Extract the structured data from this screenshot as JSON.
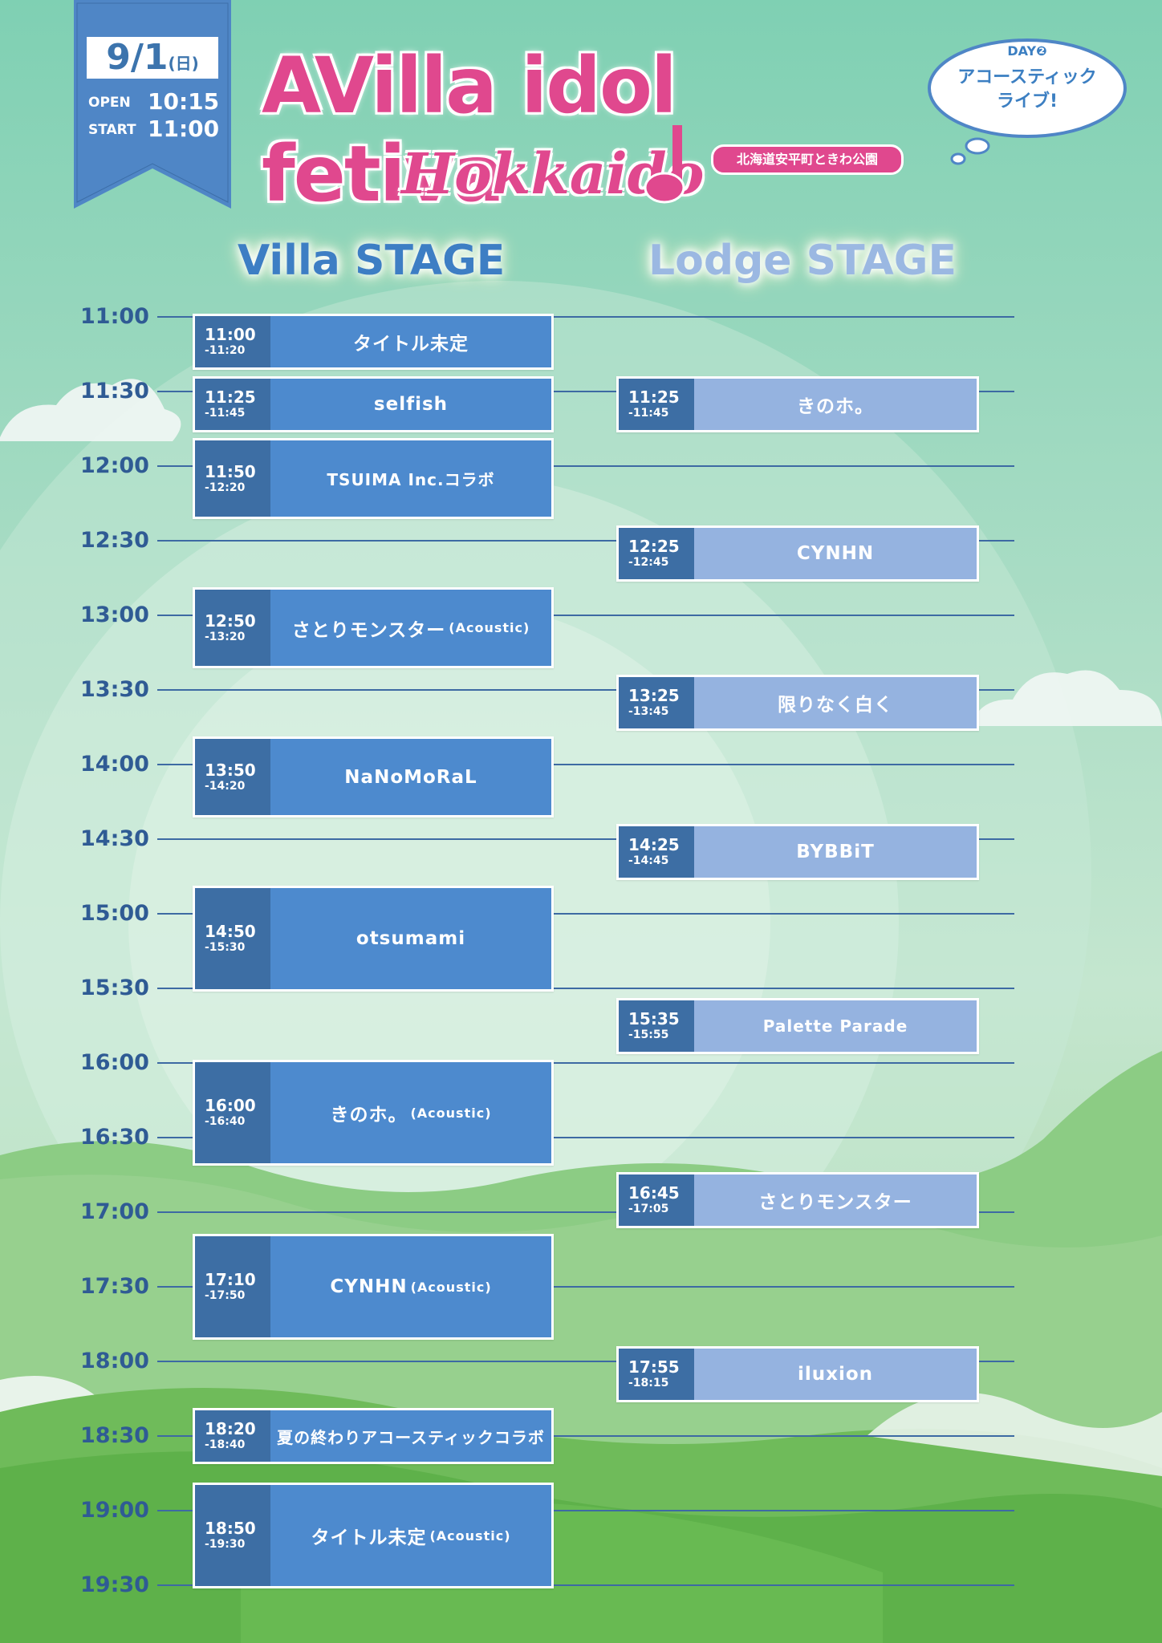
{
  "header": {
    "date": "9/1",
    "weekday": "(日)",
    "open_label": "OPEN",
    "open_time": "10:15",
    "start_label": "START",
    "start_time": "11:00",
    "title_main": "AVilla idol fetiva",
    "title_sub": "Hokkaido",
    "venue": "北海道安平町ときわ公園",
    "bubble_day": "DAY❷",
    "bubble_line1": "アコースティック",
    "bubble_line2": "ライブ!"
  },
  "stages": {
    "villa": "Villa STAGE",
    "lodge": "Lodge STAGE"
  },
  "colors": {
    "title_pink": "#e0488e",
    "villa_block": "#4d8ace",
    "lodge_block": "#95b3e0",
    "ribbon_blue": "#4f86c6"
  },
  "times": [
    "11:00",
    "11:30",
    "12:00",
    "12:30",
    "13:00",
    "13:30",
    "14:00",
    "14:30",
    "15:00",
    "15:30",
    "16:00",
    "16:30",
    "17:00",
    "17:30",
    "18:00",
    "18:30",
    "19:00",
    "19:30"
  ],
  "villa_slots": [
    {
      "start": "11:00",
      "end": "-11:20",
      "name": "タイトル未定",
      "sub": ""
    },
    {
      "start": "11:25",
      "end": "-11:45",
      "name": "selfish",
      "sub": ""
    },
    {
      "start": "11:50",
      "end": "-12:20",
      "name": "TSUIMA Inc.コラボ",
      "sub": ""
    },
    {
      "start": "12:50",
      "end": "-13:20",
      "name": "さとりモンスター",
      "sub": "(Acoustic)"
    },
    {
      "start": "13:50",
      "end": "-14:20",
      "name": "NaNoMoRaL",
      "sub": ""
    },
    {
      "start": "14:50",
      "end": "-15:30",
      "name": "otsumami",
      "sub": ""
    },
    {
      "start": "16:00",
      "end": "-16:40",
      "name": "きのホ。",
      "sub": "(Acoustic)"
    },
    {
      "start": "17:10",
      "end": "-17:50",
      "name": "CYNHN",
      "sub": "(Acoustic)"
    },
    {
      "start": "18:20",
      "end": "-18:40",
      "name": "夏の終わりアコースティックコラボ",
      "sub": ""
    },
    {
      "start": "18:50",
      "end": "-19:30",
      "name": "タイトル未定",
      "sub": "(Acoustic)"
    }
  ],
  "lodge_slots": [
    {
      "start": "11:25",
      "end": "-11:45",
      "name": "きのホ。",
      "sub": ""
    },
    {
      "start": "12:25",
      "end": "-12:45",
      "name": "CYNHN",
      "sub": ""
    },
    {
      "start": "13:25",
      "end": "-13:45",
      "name": "限りなく白く",
      "sub": ""
    },
    {
      "start": "14:25",
      "end": "-14:45",
      "name": "BYBBiT",
      "sub": ""
    },
    {
      "start": "15:35",
      "end": "-15:55",
      "name": "Palette Parade",
      "sub": ""
    },
    {
      "start": "16:45",
      "end": "-17:05",
      "name": "さとりモンスター",
      "sub": ""
    },
    {
      "start": "17:55",
      "end": "-18:15",
      "name": "iluxion",
      "sub": ""
    }
  ]
}
